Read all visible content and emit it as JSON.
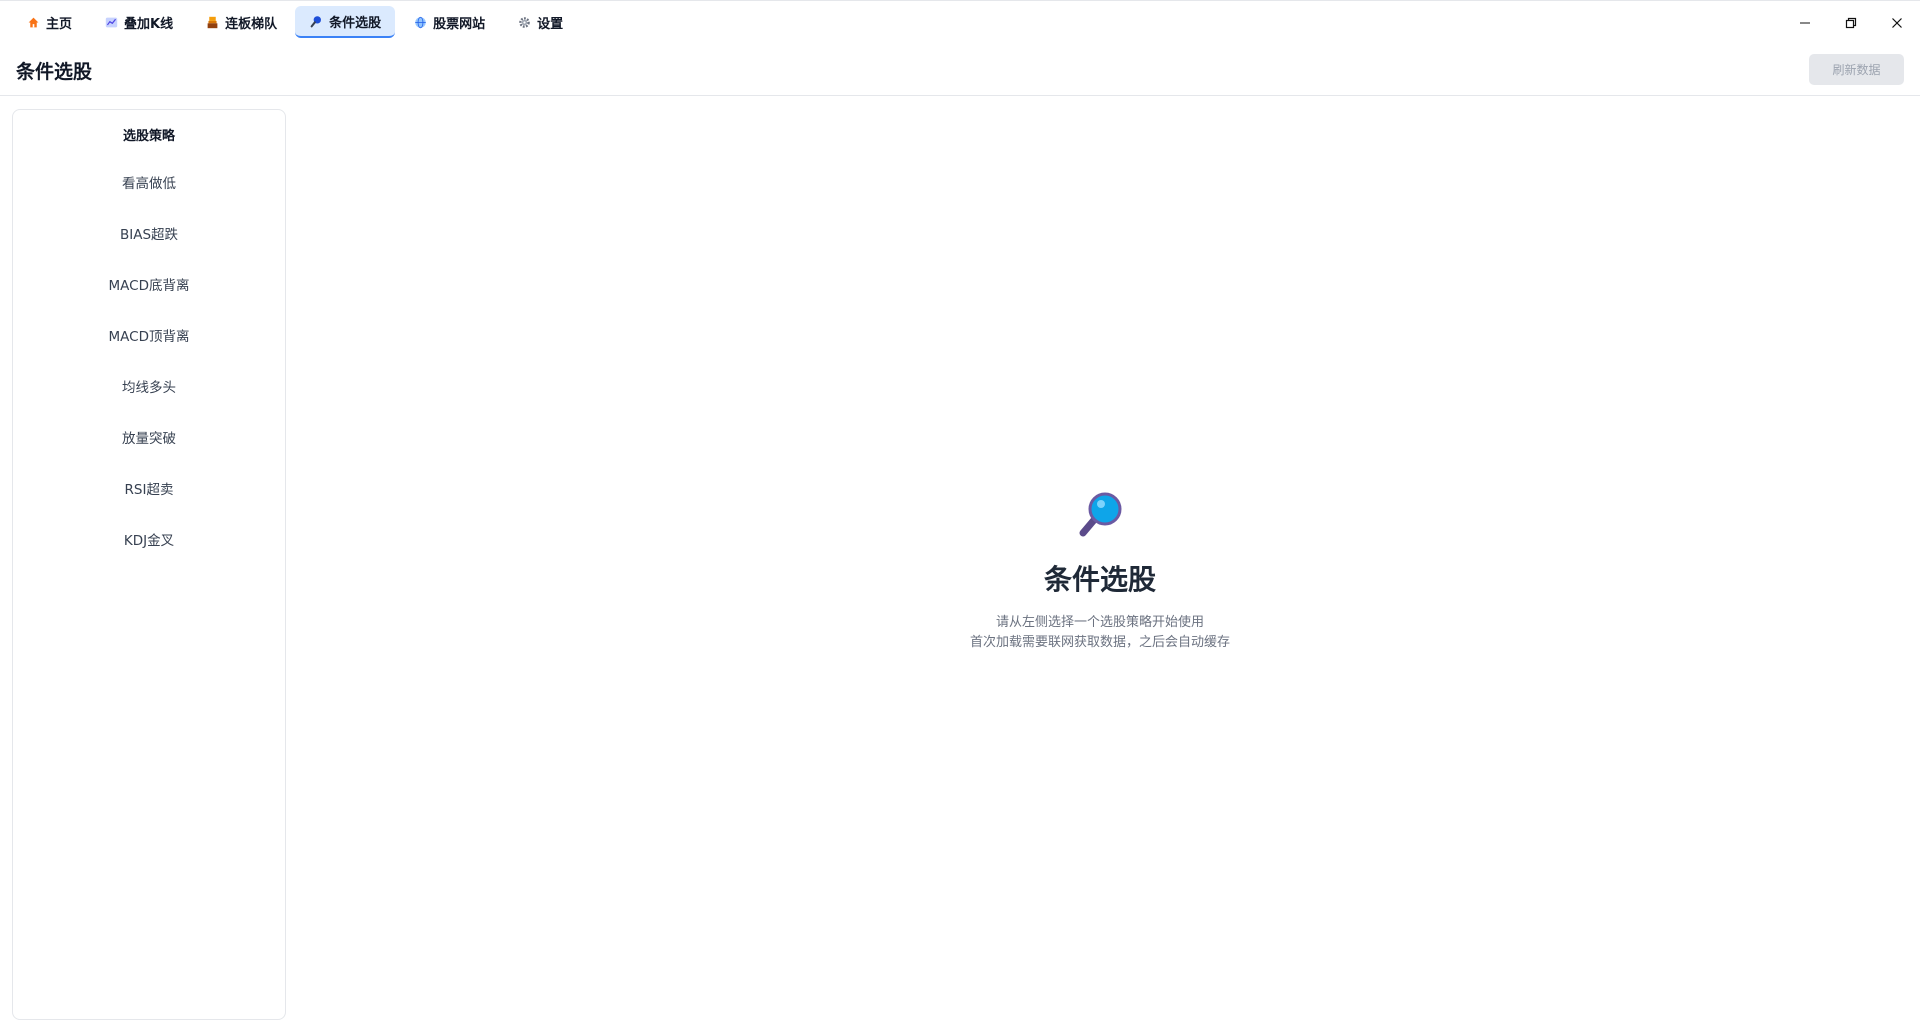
{
  "tabs": [
    {
      "label": "主页",
      "icon": "home-icon"
    },
    {
      "label": "叠加K线",
      "icon": "chart-icon"
    },
    {
      "label": "连板梯队",
      "icon": "ladder-icon"
    },
    {
      "label": "条件选股",
      "icon": "search-icon",
      "active": true
    },
    {
      "label": "股票网站",
      "icon": "globe-icon"
    },
    {
      "label": "设置",
      "icon": "gear-icon"
    }
  ],
  "header": {
    "title": "条件选股",
    "refresh_label": "刷新数据"
  },
  "sidebar": {
    "title": "选股策略",
    "items": [
      {
        "label": "看高做低"
      },
      {
        "label": "BIAS超跌"
      },
      {
        "label": "MACD底背离"
      },
      {
        "label": "MACD顶背离"
      },
      {
        "label": "均线多头"
      },
      {
        "label": "放量突破"
      },
      {
        "label": "RSI超卖"
      },
      {
        "label": "KDJ金叉"
      }
    ]
  },
  "empty_state": {
    "icon": "magnifier-icon",
    "title": "条件选股",
    "line1": "请从左侧选择一个选股策略开始使用",
    "line2": "首次加载需要联网获取数据，之后会自动缓存"
  },
  "colors": {
    "active_tab_bg": "#dbeafe",
    "accent": "#3b82f6",
    "disabled_btn_bg": "#e5e7eb"
  }
}
